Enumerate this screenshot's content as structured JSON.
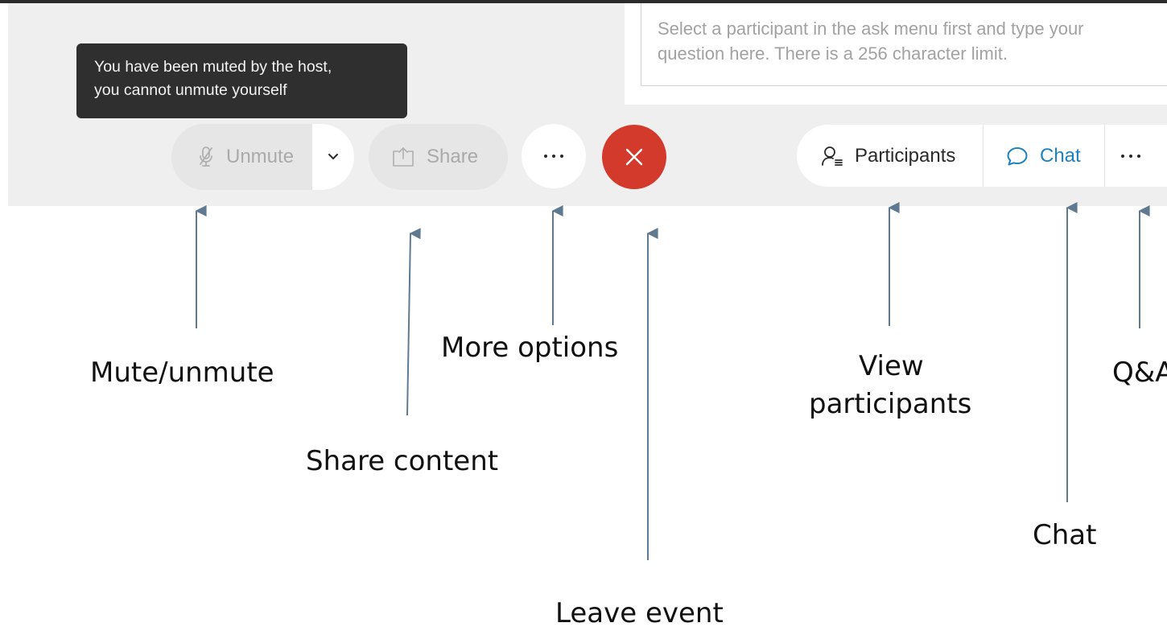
{
  "toolbar": {
    "unmute_label": "Unmute",
    "share_label": "Share"
  },
  "tooltip": {
    "line1": "You have been muted by the host,",
    "line2": "you cannot unmute yourself"
  },
  "qa": {
    "placeholder": "Select a participant in the ask menu first and type your question here. There is a 256 character limit."
  },
  "right_controls": {
    "participants_label": "Participants",
    "chat_label": "Chat"
  },
  "callouts": {
    "mute": "Mute/unmute",
    "share": "Share content",
    "more": "More options",
    "leave": "Leave event",
    "participants_line1": "View",
    "participants_line2": "participants",
    "chat": "Chat",
    "qa": "Q&A"
  },
  "colors": {
    "leave_red": "#d43a2c",
    "chat_blue": "#1e82c0",
    "arrow": "#5f7a90"
  }
}
